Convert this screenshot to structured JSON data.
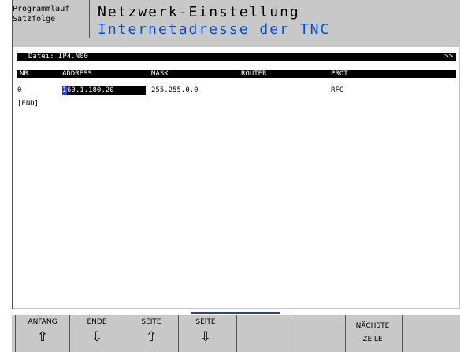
{
  "header": {
    "mode_line1": "Programmlauf",
    "mode_line2": "Satzfolge",
    "title": "Netzwerk-Einstellung",
    "subtitle": "Internetadresse der TNC"
  },
  "file_bar": {
    "label": "Datei: IP4.N00",
    "more_indicator": ">>"
  },
  "table": {
    "columns": [
      "NR",
      "ADDRESS",
      "MASK",
      "ROUTER",
      "PROT"
    ],
    "rows": [
      {
        "nr": "0",
        "address_cursor_char": "1",
        "address_rest": "60.1.180.20",
        "mask": "255.255.0.0",
        "router": "",
        "prot": "RFC"
      }
    ],
    "end_marker": "[END]"
  },
  "softkeys": [
    {
      "label": "ANFANG",
      "arrow": "⇧"
    },
    {
      "label": "ENDE",
      "arrow": "⇩"
    },
    {
      "label": "SEITE",
      "arrow": "⇧"
    },
    {
      "label": "SEITE",
      "arrow": "⇩"
    },
    {
      "label": "",
      "arrow": ""
    },
    {
      "label": "",
      "arrow": ""
    },
    {
      "label": "NÄCHSTE",
      "label2": "ZEILE"
    },
    {
      "label": "",
      "arrow": ""
    }
  ],
  "colors": {
    "background": "#c8c8c8",
    "title_blue": "#0050e0",
    "cursor_blue": "#2040ff"
  }
}
